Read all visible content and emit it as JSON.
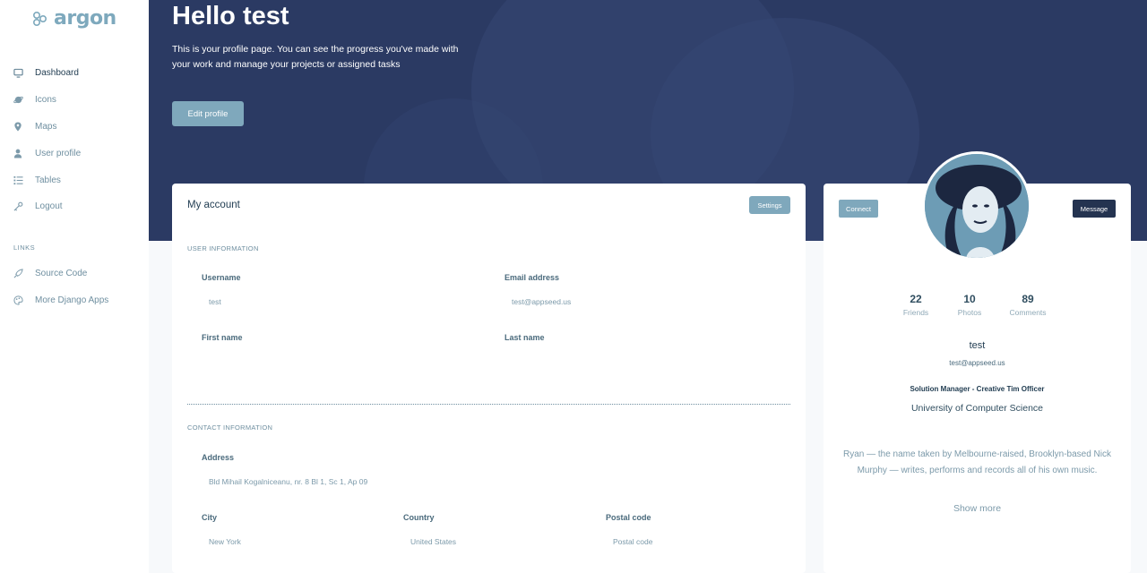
{
  "brand": {
    "name": "argon"
  },
  "sidebar": {
    "items": [
      {
        "label": "Dashboard",
        "icon": "monitor-icon",
        "active": true
      },
      {
        "label": "Icons",
        "icon": "planet-icon"
      },
      {
        "label": "Maps",
        "icon": "pin-icon"
      },
      {
        "label": "User profile",
        "icon": "user-icon"
      },
      {
        "label": "Tables",
        "icon": "bullet-list-icon"
      },
      {
        "label": "Logout",
        "icon": "key-icon"
      }
    ],
    "links_heading": "LINKS",
    "links": [
      {
        "label": "Source Code",
        "icon": "spaceship-icon"
      },
      {
        "label": "More Django Apps",
        "icon": "palette-icon"
      }
    ]
  },
  "header": {
    "title": "Hello test",
    "description": "This is your profile page. You can see the progress you've made with your work and manage your projects or assigned tasks",
    "edit_button": "Edit profile"
  },
  "account": {
    "title": "My account",
    "settings_button": "Settings",
    "user_info_heading": "USER INFORMATION",
    "username_label": "Username",
    "username_value": "test",
    "email_label": "Email address",
    "email_value": "test@appseed.us",
    "first_name_label": "First name",
    "last_name_label": "Last name",
    "contact_heading": "CONTACT INFORMATION",
    "address_label": "Address",
    "address_value": "Bld Mihail Kogalniceanu, nr. 8 Bl 1, Sc 1, Ap 09",
    "city_label": "City",
    "city_value": "New York",
    "country_label": "Country",
    "country_value": "United States",
    "postal_label": "Postal code",
    "postal_placeholder": "Postal code"
  },
  "profile": {
    "connect_button": "Connect",
    "message_button": "Message",
    "stats": [
      {
        "value": "22",
        "label": "Friends"
      },
      {
        "value": "10",
        "label": "Photos"
      },
      {
        "value": "89",
        "label": "Comments"
      }
    ],
    "name": "test",
    "email": "test@appseed.us",
    "job": "Solution Manager - Creative Tim Officer",
    "university": "University of Computer Science",
    "bio": "Ryan — the name taken by Melbourne-raised, Brooklyn-based Nick Murphy — writes, performs and records all of his own music.",
    "show_more": "Show more"
  },
  "colors": {
    "hero": "#2b3a63",
    "accent": "#7fa8bc",
    "dark_button": "#243350",
    "background": "#f7f9fb"
  }
}
